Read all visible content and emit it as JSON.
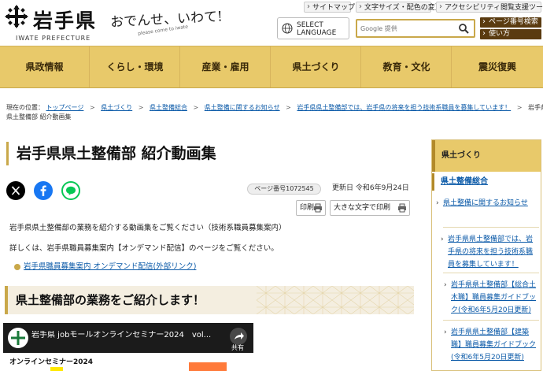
{
  "header": {
    "logo_title": "岩手県",
    "logo_en": "IWATE PREFECTURE",
    "catchphrase": "おでんせ、いわて!",
    "catchphrase_sub": "please come to iwate",
    "utility_links": [
      "サイトマップ",
      "文字サイズ・配色の変更",
      "アクセシビリティ閲覧支援ツール"
    ],
    "language_label": "SELECT LANGUAGE",
    "search_placeholder": "Google 提供",
    "side_buttons": [
      "ページ番号検索",
      "使い方"
    ]
  },
  "gnav": {
    "items": [
      "県政情報",
      "くらし・環境",
      "産業・雇用",
      "県土づくり",
      "教育・文化",
      "震災復興"
    ]
  },
  "breadcrumb": {
    "label": "現在の位置：",
    "items": [
      "トップページ",
      "県土づくり",
      "県土整備総合",
      "県土整備に関するお知らせ",
      "岩手県県土整備部では、岩手県の将来を担う技術系職員を募集しています！",
      "岩手県"
    ],
    "current": "県土整備部 紹介動画集"
  },
  "main": {
    "title": "岩手県県土整備部 紹介動画集",
    "page_number": "ページ番号1072545",
    "updated": "更新日 令和6年9月24日",
    "print_label": "印刷",
    "print_large_label": "大きな文字で印刷",
    "para1": "岩手県県土整備部の業務を紹介する動画集をご覧ください（技術系職員募集案内）",
    "para2": "詳しくは、岩手県職員募集案内【オンデマンド配信】のページをご覧ください。",
    "ext_link": "岩手県職員募集案内 オンデマンド配信(外部リンク)",
    "section_heading": "県土整備部の業務をご紹介します！"
  },
  "video": {
    "title": "岩手県 jobモールオンラインセミナー2024　vol...",
    "share_label": "共有",
    "sub_text": "オンラインセミナー2024"
  },
  "sidenav": {
    "heading": "県土づくり",
    "current": "県土整備総合",
    "links": [
      "県土整備に関するお知らせ",
      "岩手県県土整備部では、岩手県の将来を担う技術系職員を募集しています！",
      "岩手県県土整備部【総合土木職】職員募集ガイドブック(令和6年5月20日更新)",
      "岩手県県土整備部【建築職】職員募集ガイドブック(令和6年5月20日更新)"
    ]
  },
  "colors": {
    "accent": "#e8c96a",
    "accent_dark": "#5a3b10",
    "link": "#0b5aa8"
  }
}
